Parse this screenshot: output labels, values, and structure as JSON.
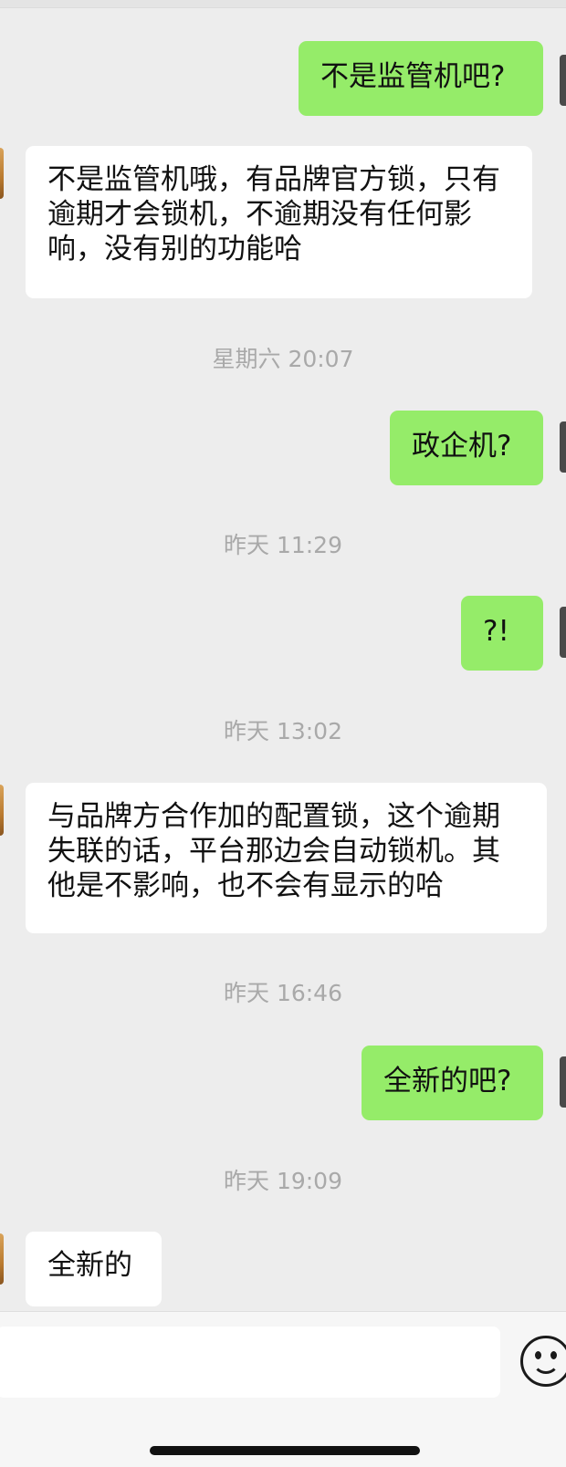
{
  "messages": [
    {
      "dir": "out",
      "text": "不是监管机吧?"
    },
    {
      "dir": "in",
      "text": "不是监管机哦，有品牌官方锁，只有逾期才会锁机，不逾期没有任何影响，没有别的功能哈"
    },
    {
      "time": "星期六 20:07"
    },
    {
      "dir": "out",
      "text": "政企机?"
    },
    {
      "time": "昨天 11:29"
    },
    {
      "dir": "out",
      "text": "?!"
    },
    {
      "time": "昨天 13:02"
    },
    {
      "dir": "in",
      "text": "与品牌方合作加的配置锁，这个逾期失联的话，平台那边会自动锁机。其他是不影响，也不会有显示的哈"
    },
    {
      "time": "昨天 16:46"
    },
    {
      "dir": "out",
      "text": "全新的吧?"
    },
    {
      "time": "昨天 19:09"
    },
    {
      "dir": "in",
      "text": "全新的"
    }
  ],
  "input": {
    "value": "",
    "emoji_icon": "smiley-face-icon"
  },
  "colors": {
    "background": "#ededed",
    "outgoing_bubble": "#95ec69",
    "incoming_bubble": "#ffffff",
    "timestamp_text": "#a9a9a9"
  }
}
